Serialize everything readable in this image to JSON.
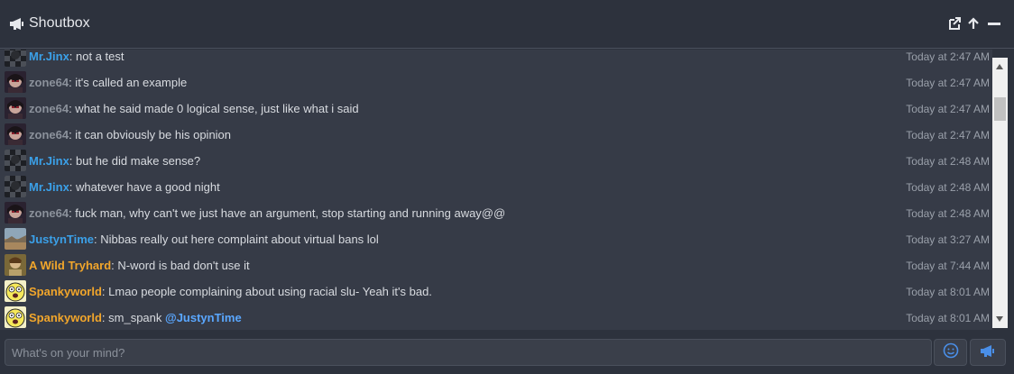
{
  "header": {
    "title": "Shoutbox",
    "icons": [
      "megaphone-icon",
      "external-link-icon",
      "arrow-up-icon",
      "minimize-icon"
    ]
  },
  "messages": [
    {
      "user": "Mr.Jinx",
      "user_color": "#3ba0e8",
      "avatar": "checker",
      "text": ": not a test",
      "time": "Today at 2:47 AM"
    },
    {
      "user": "zone64",
      "user_color": "#8b919b",
      "avatar": "anime",
      "text": ": it's called an example",
      "time": "Today at 2:47 AM"
    },
    {
      "user": "zone64",
      "user_color": "#8b919b",
      "avatar": "anime",
      "text": ": what he said made 0 logical sense, just like what i said",
      "time": "Today at 2:47 AM"
    },
    {
      "user": "zone64",
      "user_color": "#8b919b",
      "avatar": "anime",
      "text": ": it can obviously be his opinion",
      "time": "Today at 2:47 AM"
    },
    {
      "user": "Mr.Jinx",
      "user_color": "#3ba0e8",
      "avatar": "checker",
      "text": ": but he did make sense?",
      "time": "Today at 2:48 AM"
    },
    {
      "user": "Mr.Jinx",
      "user_color": "#3ba0e8",
      "avatar": "checker",
      "text": ": whatever have a good night",
      "time": "Today at 2:48 AM"
    },
    {
      "user": "zone64",
      "user_color": "#8b919b",
      "avatar": "anime",
      "text": ": fuck man, why can't we just have an argument, stop starting and running away@@",
      "time": "Today at 2:48 AM"
    },
    {
      "user": "JustynTime",
      "user_color": "#3ba0e8",
      "avatar": "desert",
      "text": ": Nibbas really out here complaint about virtual bans lol",
      "time": "Today at 3:27 AM"
    },
    {
      "user": "A Wild Tryhard",
      "user_color": "#f2a62b",
      "avatar": "portrait",
      "text": ": N-word is bad don't use it",
      "time": "Today at 7:44 AM"
    },
    {
      "user": "Spankyworld",
      "user_color": "#f2a62b",
      "avatar": "smiley",
      "text": ": Lmao people complaining about using racial slu- Yeah it's bad.",
      "time": "Today at 8:01 AM"
    },
    {
      "user": "Spankyworld",
      "user_color": "#f2a62b",
      "avatar": "smiley",
      "text": ": sm_spank ",
      "mention": "@JustynTime",
      "time": "Today at 8:01 AM"
    }
  ],
  "composer": {
    "placeholder": "What's on your mind?"
  }
}
